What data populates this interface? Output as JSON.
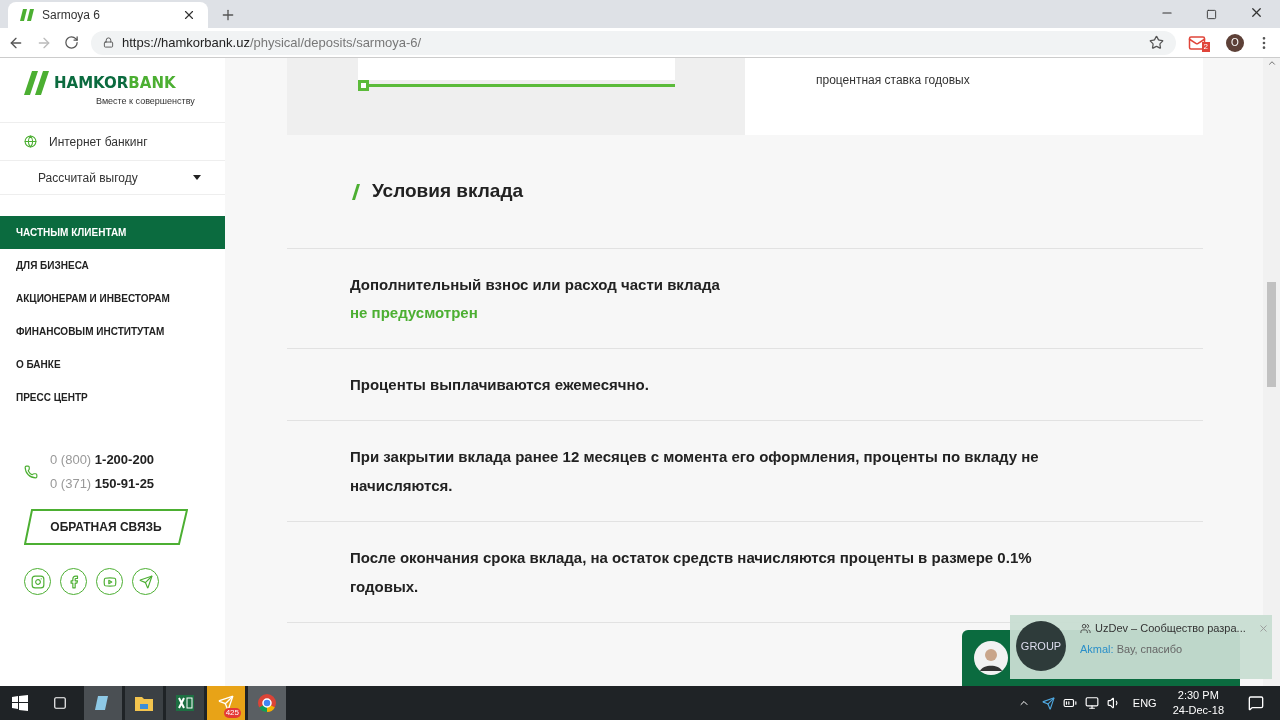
{
  "browser": {
    "tab_title": "Sarmoya 6",
    "url_host": "https://hamkorbank.uz",
    "url_path": "/physical/deposits/sarmoya-6/",
    "mail_badge": "2",
    "profile_initial": "O"
  },
  "sidebar": {
    "tagline": "Вместе к совершенству",
    "logo_dark": "HAMKOR",
    "logo_light": "BANK",
    "internet_banking": "Интернет банкинг",
    "calc": "Рассчитай выгоду",
    "nav": [
      {
        "label": "ЧАСТНЫМ КЛИЕНТАМ",
        "selected": true
      },
      {
        "label": "ДЛЯ БИЗНЕСА",
        "selected": false
      },
      {
        "label": "АКЦИОНЕРАМ И ИНВЕСТОРАМ",
        "selected": false
      },
      {
        "label": "ФИНАНСОВЫМ ИНСТИТУТАМ",
        "selected": false
      },
      {
        "label": "О БАНКЕ",
        "selected": false
      },
      {
        "label": "ПРЕСС ЦЕНТР",
        "selected": false
      }
    ],
    "phones": [
      {
        "code": "0 (800)",
        "number": "1-200-200"
      },
      {
        "code": "0 (371)",
        "number": "150-91-25"
      }
    ],
    "feedback": "ОБРАТНАЯ СВЯЗЬ"
  },
  "top_panel": {
    "term_slider": {
      "level": 0
    },
    "rate_caption": "процентная ставка годовых"
  },
  "conditions": {
    "title": "Условия вклада",
    "rows": [
      {
        "text": "Дополнительный взнос или расход части вклада",
        "value": "не предусмотрен"
      },
      {
        "text": "Проценты выплачиваются ежемесячно."
      },
      {
        "text": "При закрытии вклада ранее 12 месяцев с момента его оформления, проценты по вкладу не начисляются."
      },
      {
        "text": "После окончания срока вклада, на остаток средств начисляются проценты в размере 0.1% годовых."
      }
    ]
  },
  "notification": {
    "avatar_text": "GROUP",
    "title": "UzDev – Сообщество разра...",
    "sender": "Akmal:",
    "message": "Вау, спасибо"
  },
  "taskbar": {
    "telegram_badge": "425",
    "language": "ENG",
    "time": "2:30 PM",
    "date": "24-Dec-18"
  }
}
